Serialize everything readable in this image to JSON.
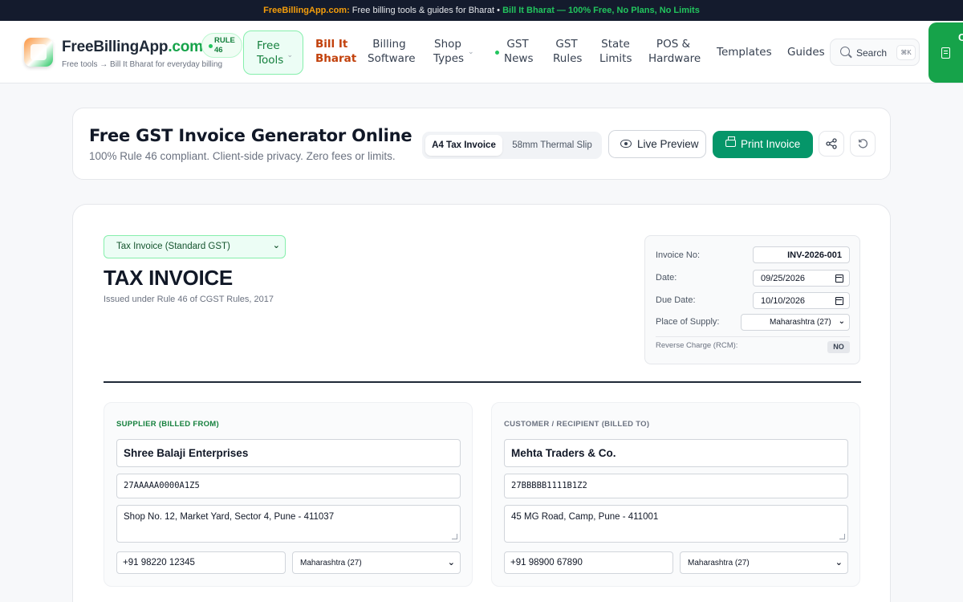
{
  "banner": {
    "brand": "FreeBillingApp.com:",
    "text": " Free billing tools & guides for Bharat • ",
    "highlight": "Bill It Bharat — 100% Free, No Plans, No Limits"
  },
  "header": {
    "logo_name": "FreeBillingApp",
    "logo_tld": ".com",
    "logo_tagline": "Free tools → Bill It Bharat for everyday billing",
    "rule_badge": [
      "RULE",
      "46"
    ],
    "nav": {
      "free_tools": [
        "Free",
        "Tools"
      ],
      "bill_it": [
        "Bill It",
        "Bharat"
      ],
      "billing_software": [
        "Billing",
        "Software"
      ],
      "shop_types": [
        "Shop",
        "Types"
      ],
      "gst_news": [
        "GST",
        "News"
      ],
      "gst_rules": [
        "GST",
        "Rules"
      ],
      "state_limits": [
        "State",
        "Limits"
      ],
      "pos_hardware": [
        "POS &",
        "Hardware"
      ],
      "templates": "Templates",
      "guides": "Guides"
    },
    "search": {
      "label": "Search",
      "shortcut": "⌘K"
    },
    "edge_button_text": "C"
  },
  "toolbar": {
    "title": "Free GST Invoice Generator Online",
    "subtitle": "100% Rule 46 compliant. Client-side privacy. Zero fees or limits.",
    "format_options": [
      "A4 Tax Invoice",
      "58mm Thermal Slip"
    ],
    "selected_format": "A4 Tax Invoice",
    "preview_label": "Live Preview",
    "print_label": "Print Invoice"
  },
  "invoice": {
    "type_select": "Tax Invoice (Standard GST)",
    "title": "TAX INVOICE",
    "subtitle": "Issued under Rule 46 of CGST Rules, 2017",
    "meta": {
      "invoice_no_label": "Invoice No:",
      "invoice_no": "INV-2026-001",
      "date_label": "Date:",
      "date": "09/25/2026",
      "due_date_label": "Due Date:",
      "due_date": "10/10/2026",
      "place_label": "Place of Supply:",
      "place": "Maharashtra (27)",
      "rcm_label": "Reverse Charge (RCM):",
      "rcm_value": "NO"
    },
    "supplier": {
      "heading": "SUPPLIER (BILLED FROM)",
      "name": "Shree Balaji Enterprises",
      "gstin": "27AAAAA0000A1Z5",
      "address": "Shop No. 12, Market Yard, Sector 4, Pune - 411037",
      "phone": "+91 98220 12345",
      "state": "Maharashtra (27)"
    },
    "customer": {
      "heading": "CUSTOMER / RECIPIENT (BILLED TO)",
      "name": "Mehta Traders & Co.",
      "gstin": "27BBBBB1111B1Z2",
      "address": "45 MG Road, Camp, Pune - 411001",
      "phone": "+91 98900 67890",
      "state": "Maharashtra (27)"
    }
  },
  "colors": {
    "accent_green": "#059669",
    "bill_it_orange": "#c2410c",
    "banner_bg": "#141b2d"
  }
}
